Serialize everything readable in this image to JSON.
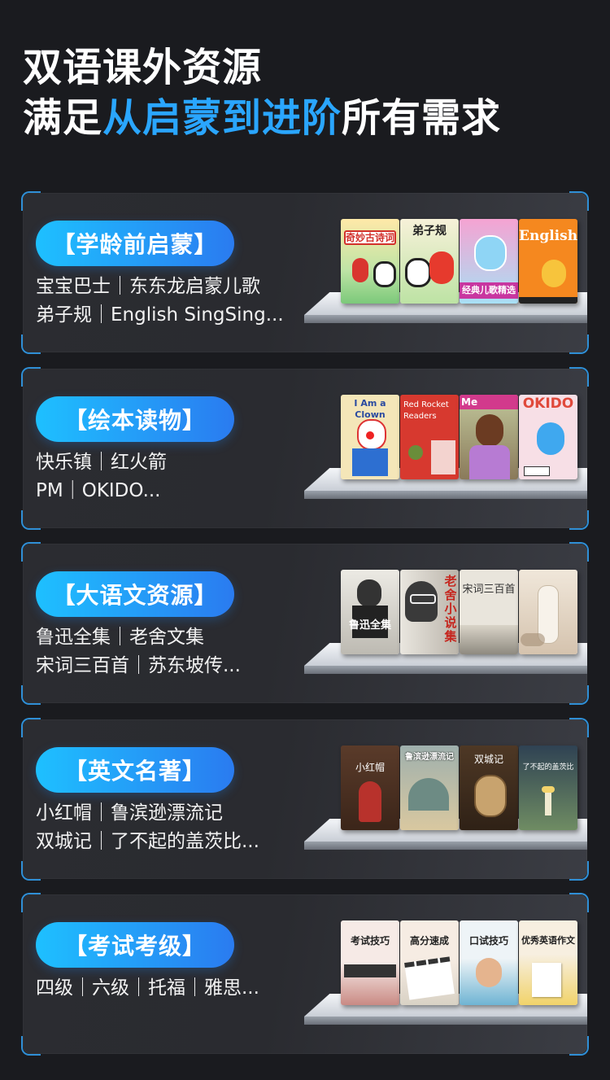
{
  "headline": {
    "line1": "双语课外资源",
    "line2_prefix": "满足",
    "line2_highlight": "从启蒙到进阶",
    "line2_suffix": "所有需求"
  },
  "colors": {
    "accent": "#2aa6ff",
    "pill_start": "#1ec0ff",
    "pill_end": "#2a7bf0",
    "background": "#1a1b1f"
  },
  "cards": [
    {
      "tag": "【学龄前启蒙】",
      "line1": "宝宝巴士｜东东龙启蒙儿歌",
      "line2": "弟子规｜English SingSing...",
      "books": [
        "奇妙古诗词",
        "弟子规",
        "经典儿歌精选",
        "English"
      ]
    },
    {
      "tag": "【绘本读物】",
      "line1": "快乐镇｜红火箭",
      "line2": "PM｜OKIDO...",
      "books": [
        "I Am a Clown",
        "Red Rocket Readers",
        "Me",
        "OKIDO"
      ]
    },
    {
      "tag": "【大语文资源】",
      "line1": "鲁迅全集｜老舍文集",
      "line2": "宋词三百首｜苏东坡传...",
      "books": [
        "鲁迅全集",
        "老舍小说集",
        "宋词三百首",
        ""
      ]
    },
    {
      "tag": "【英文名著】",
      "line1": "小红帽｜鲁滨逊漂流记",
      "line2": "双城记｜了不起的盖茨比...",
      "books": [
        "小红帽",
        "鲁滨逊漂流记",
        "双城记",
        "了不起的盖茨比"
      ]
    },
    {
      "tag": "【考试考级】",
      "line1": "四级｜六级｜托福｜雅思...",
      "line2": "",
      "books": [
        "考试技巧",
        "高分速成",
        "口试技巧",
        "优秀英语作文"
      ]
    }
  ]
}
